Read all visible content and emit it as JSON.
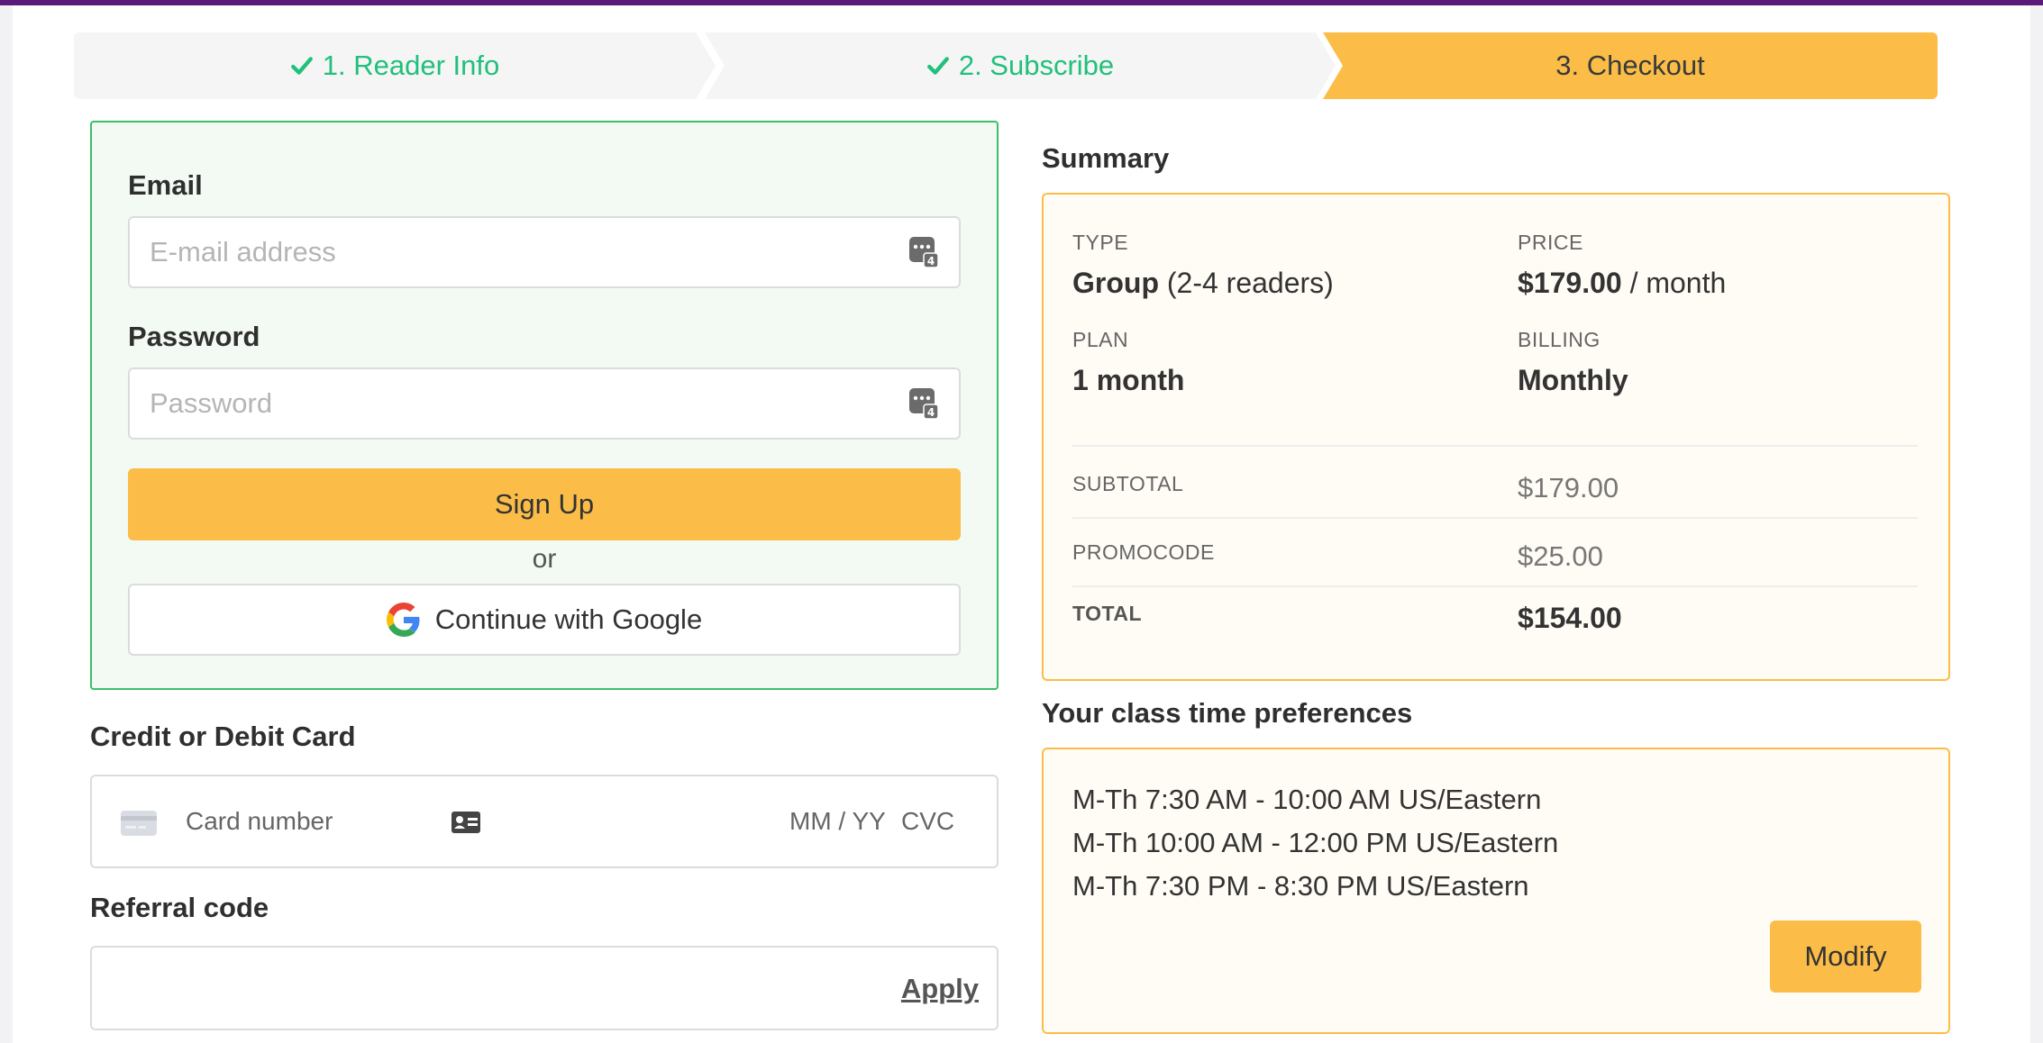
{
  "stepper": {
    "steps": [
      {
        "label": "1. Reader Info",
        "state": "complete"
      },
      {
        "label": "2. Subscribe",
        "state": "complete"
      },
      {
        "label": "3. Checkout",
        "state": "active"
      }
    ]
  },
  "signup": {
    "email_label": "Email",
    "email_placeholder": "E-mail address",
    "password_label": "Password",
    "password_placeholder": "Password",
    "signup_button": "Sign Up",
    "or_text": "or",
    "google_button": "Continue with Google"
  },
  "card": {
    "title": "Credit or Debit Card",
    "number_placeholder": "Card number",
    "expiry_placeholder": "MM / YY",
    "cvc_placeholder": "CVC"
  },
  "referral": {
    "title": "Referral code",
    "value": "",
    "apply_label": "Apply"
  },
  "summary": {
    "title": "Summary",
    "type_label": "TYPE",
    "type_value": "Group",
    "type_detail": "(2-4 readers)",
    "price_label": "PRICE",
    "price_value": "$179.00",
    "price_unit": "/ month",
    "plan_label": "PLAN",
    "plan_value": "1 month",
    "billing_label": "BILLING",
    "billing_value": "Monthly",
    "subtotal_label": "SUBTOTAL",
    "subtotal_value": "$179.00",
    "promocode_label": "PROMOCODE",
    "promocode_value": "$25.00",
    "total_label": "TOTAL",
    "total_value": "$154.00"
  },
  "preferences": {
    "title": "Your class time preferences",
    "times": [
      "M-Th 7:30 AM - 10:00 AM US/Eastern",
      "M-Th 10:00 AM - 12:00 PM US/Eastern",
      "M-Th 7:30 PM - 8:30 PM US/Eastern"
    ],
    "modify_button": "Modify"
  },
  "colors": {
    "accent": "#fbbd48",
    "success": "#21c07c",
    "success_border": "#3cbf68",
    "topbar": "#5b1a7a"
  },
  "icons": {
    "step_complete": "check-icon",
    "password_manager": "key-badge-icon",
    "google": "google-g-icon",
    "card": "credit-card-icon",
    "card_id": "id-card-icon"
  }
}
